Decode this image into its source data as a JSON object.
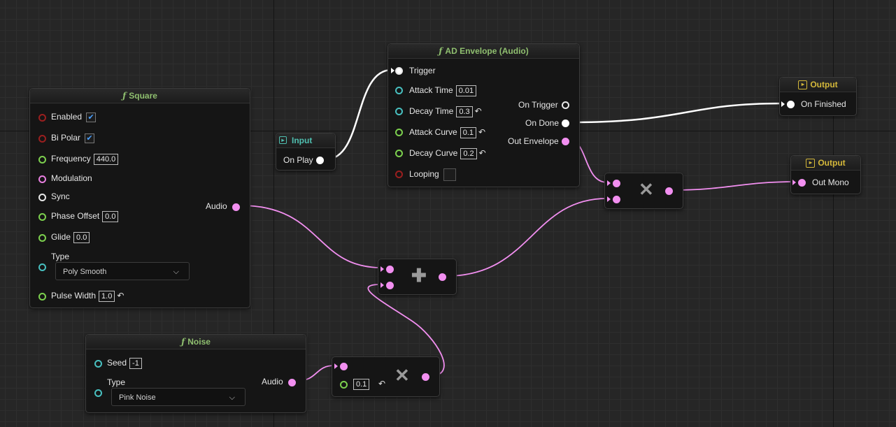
{
  "nodes": {
    "square": {
      "title": "Square",
      "enabled": "Enabled",
      "bipolar": "Bi Polar",
      "frequency": "Frequency",
      "frequency_value": "440.0",
      "modulation": "Modulation",
      "sync": "Sync",
      "phase_offset": "Phase Offset",
      "phase_offset_value": "0.0",
      "glide": "Glide",
      "glide_value": "0.0",
      "type": "Type",
      "type_value": "Poly Smooth",
      "pulse_width": "Pulse Width",
      "pulse_width_value": "1.0",
      "audio": "Audio"
    },
    "input": {
      "title": "Input",
      "on_play": "On Play"
    },
    "ad_envelope": {
      "title": "AD Envelope (Audio)",
      "trigger": "Trigger",
      "attack_time": "Attack Time",
      "attack_time_value": "0.01",
      "decay_time": "Decay Time",
      "decay_time_value": "0.3",
      "attack_curve": "Attack Curve",
      "attack_curve_value": "0.1",
      "decay_curve": "Decay Curve",
      "decay_curve_value": "0.2",
      "looping": "Looping",
      "on_trigger": "On Trigger",
      "on_done": "On Done",
      "out_envelope": "Out Envelope"
    },
    "output_finished": {
      "title": "Output",
      "pin": "On Finished"
    },
    "output_mono": {
      "title": "Output",
      "pin": "Out Mono"
    },
    "noise": {
      "title": "Noise",
      "seed": "Seed",
      "seed_value": "-1",
      "type": "Type",
      "type_value": "Pink Noise",
      "audio": "Audio"
    },
    "multiply_noise": {
      "value": "0.1"
    }
  },
  "icons": {
    "function": "function-icon",
    "input": "input-icon",
    "output": "output-icon",
    "add": "add-operator-icon",
    "multiply": "multiply-operator-icon",
    "reset": "reset-arrow-icon",
    "check": "checkmark-icon",
    "chevron": "chevron-down-icon"
  },
  "colors": {
    "audio_wire": "#f28ff0",
    "exec_wire": "#ffffff",
    "function_title": "#8fbf6f",
    "input_title": "#4fbfb0",
    "output_title": "#d4b83a"
  }
}
